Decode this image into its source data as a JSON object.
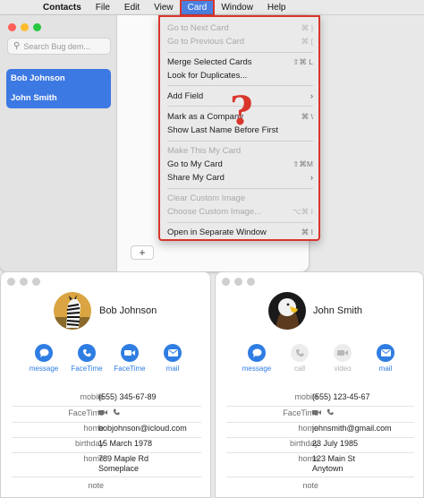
{
  "menubar": {
    "app": "Contacts",
    "items": [
      "File",
      "Edit",
      "View",
      "Card",
      "Window",
      "Help"
    ]
  },
  "sidebar": {
    "search_placeholder": "Search Bug dem...",
    "contacts": [
      "Bob Johnson",
      "John Smith"
    ]
  },
  "add_button": "+",
  "card_menu": [
    {
      "label": "Go to Next Card",
      "shortcut": "⌘ ]",
      "enabled": false
    },
    {
      "label": "Go to Previous Card",
      "shortcut": "⌘ [",
      "enabled": false
    },
    {
      "label": "Merge Selected Cards",
      "shortcut": "⇧⌘ L",
      "enabled": true
    },
    {
      "label": "Look for Duplicates...",
      "shortcut": "",
      "enabled": true
    },
    {
      "label": "Add Field",
      "shortcut": "",
      "enabled": true,
      "submenu": true
    },
    {
      "label": "Mark as a Company",
      "shortcut": "⌘ \\",
      "enabled": true
    },
    {
      "label": "Show Last Name Before First",
      "shortcut": "",
      "enabled": true
    },
    {
      "label": "Make This My Card",
      "shortcut": "",
      "enabled": false
    },
    {
      "label": "Go to My Card",
      "shortcut": "⇧⌘M",
      "enabled": true
    },
    {
      "label": "Share My Card",
      "shortcut": "",
      "enabled": true,
      "submenu": true
    },
    {
      "label": "Clear Custom Image",
      "shortcut": "",
      "enabled": false
    },
    {
      "label": "Choose Custom Image...",
      "shortcut": "⌥⌘ I",
      "enabled": false
    },
    {
      "label": "Open in Separate Window",
      "shortcut": "⌘ I",
      "enabled": true
    }
  ],
  "annotation": "?",
  "cards": [
    {
      "name": "Bob Johnson",
      "actions": [
        {
          "label": "message",
          "icon": "message-icon",
          "enabled": true
        },
        {
          "label": "FaceTime",
          "icon": "phone-icon",
          "enabled": true
        },
        {
          "label": "FaceTime",
          "icon": "video-icon",
          "enabled": true
        },
        {
          "label": "mail",
          "icon": "mail-icon",
          "enabled": true
        }
      ],
      "fields": [
        {
          "key": "mobile",
          "value": "(555) 345-67-89"
        },
        {
          "key": "FaceTime",
          "value": ""
        },
        {
          "key": "home",
          "value": "bobjohnson@icloud.com"
        },
        {
          "key": "birthday",
          "value": "15 March 1978"
        },
        {
          "key": "home",
          "value": "789 Maple Rd",
          "value2": "Someplace"
        },
        {
          "key": "note",
          "value": ""
        }
      ]
    },
    {
      "name": "John Smith",
      "actions": [
        {
          "label": "message",
          "icon": "message-icon",
          "enabled": true
        },
        {
          "label": "call",
          "icon": "phone-icon",
          "enabled": false
        },
        {
          "label": "video",
          "icon": "video-icon",
          "enabled": false
        },
        {
          "label": "mail",
          "icon": "mail-icon",
          "enabled": true
        }
      ],
      "fields": [
        {
          "key": "mobile",
          "value": "(555) 123-45-67"
        },
        {
          "key": "FaceTime",
          "value": ""
        },
        {
          "key": "home",
          "value": "johnsmith@gmail.com"
        },
        {
          "key": "birthday",
          "value": "23 July 1985"
        },
        {
          "key": "home",
          "value": "123 Main St",
          "value2": "Anytown"
        },
        {
          "key": "note",
          "value": ""
        }
      ]
    }
  ],
  "colors": {
    "accent": "#2f7de3",
    "selection": "#3d79e3",
    "highlight": "#d9362b"
  }
}
